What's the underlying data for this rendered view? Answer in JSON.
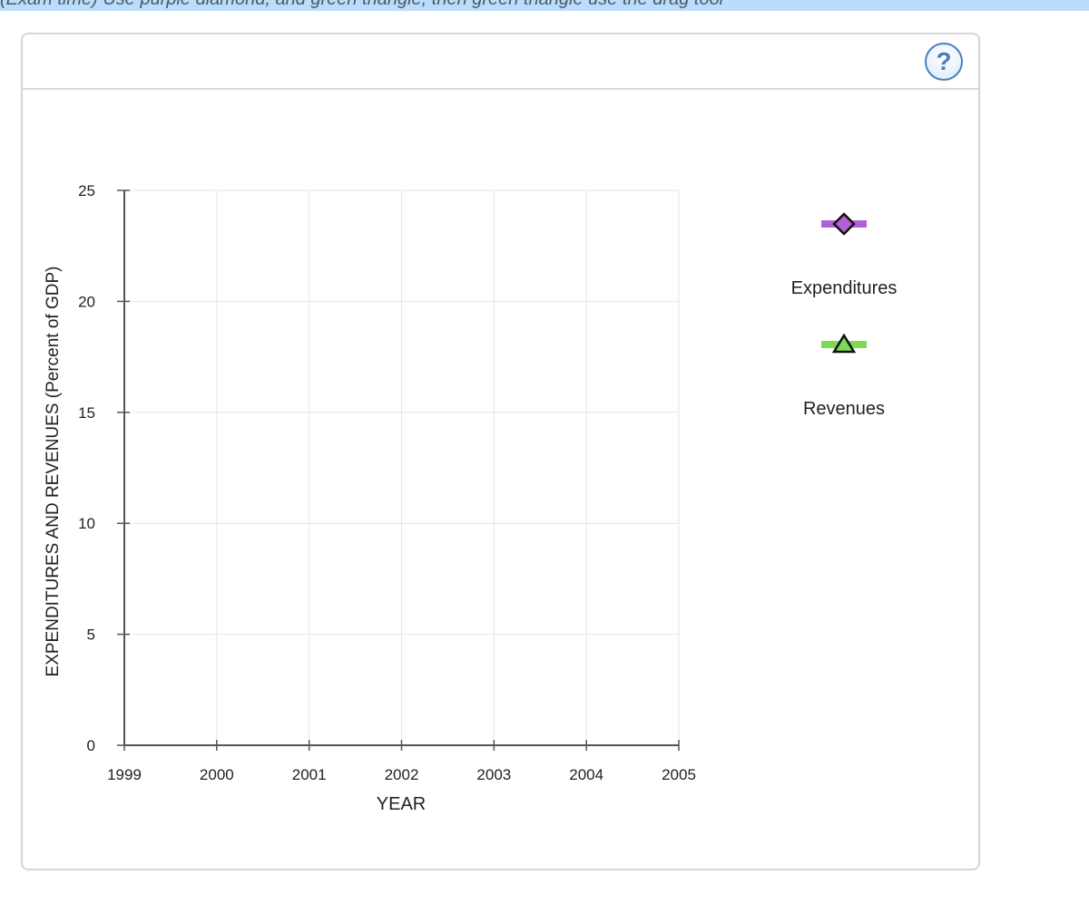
{
  "instructions_fragment": "(Exam time) Use purple diamond, and green triangle, then green triangle use the drag tool",
  "help": {
    "label": "?"
  },
  "chart_data": {
    "type": "line",
    "title": "",
    "xlabel": "YEAR",
    "ylabel": "EXPENDITURES AND REVENUES (Percent of GDP)",
    "xlim": [
      1999,
      2005
    ],
    "ylim": [
      0,
      25
    ],
    "x_ticks": [
      1999,
      2000,
      2001,
      2002,
      2003,
      2004,
      2005
    ],
    "y_ticks": [
      0,
      5,
      10,
      15,
      20,
      25
    ],
    "grid": true,
    "legend_placement": "right",
    "series": [
      {
        "name": "Expenditures",
        "marker": "diamond",
        "color": "#b35fd6",
        "points": []
      },
      {
        "name": "Revenues",
        "marker": "triangle",
        "color": "#7ed957",
        "points": []
      }
    ]
  }
}
